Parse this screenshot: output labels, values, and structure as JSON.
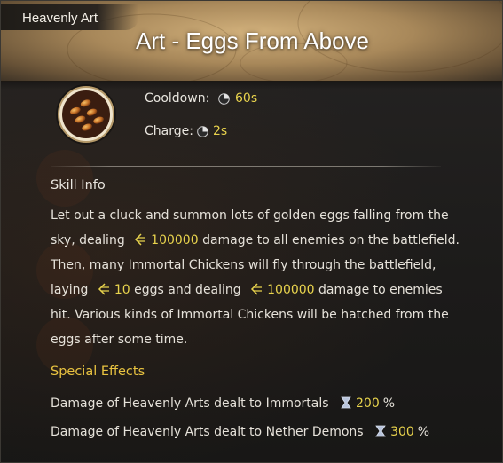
{
  "header": {
    "category": "Heavenly Art",
    "title": "Art - Eggs From Above"
  },
  "skill_icon": "golden-eggs-icon",
  "stats": {
    "cooldown_label": "Cooldown:",
    "cooldown_value": "60s",
    "charge_label": "Charge:",
    "charge_value": "2s"
  },
  "skill_info": {
    "title": "Skill Info",
    "line1": "Let out a cluck and summon lots of golden eggs falling from the",
    "line2_a": "sky, dealing",
    "line2_num": "100000",
    "line2_b": "damage to all enemies on the battlefield.",
    "line3": "Then, many Immortal Chickens will fly through the battlefield,",
    "line4_a": "laying",
    "line4_num1": "10",
    "line4_b": "eggs and dealing",
    "line4_num2": "100000",
    "line4_c": "damage to enemies",
    "line5": "hit. Various kinds of Immortal Chickens will be hatched from the",
    "line6": "eggs after some time."
  },
  "special_effects": {
    "title": "Special Effects",
    "items": [
      {
        "label": "Damage of Heavenly Arts dealt to Immortals",
        "value": "200",
        "unit": "%"
      },
      {
        "label": "Damage of Heavenly Arts dealt to Nether Demons",
        "value": "300",
        "unit": "%"
      }
    ]
  },
  "colors": {
    "highlight": "#e8d34d",
    "special_title": "#e8c340",
    "header_gold": "#c9a873"
  }
}
